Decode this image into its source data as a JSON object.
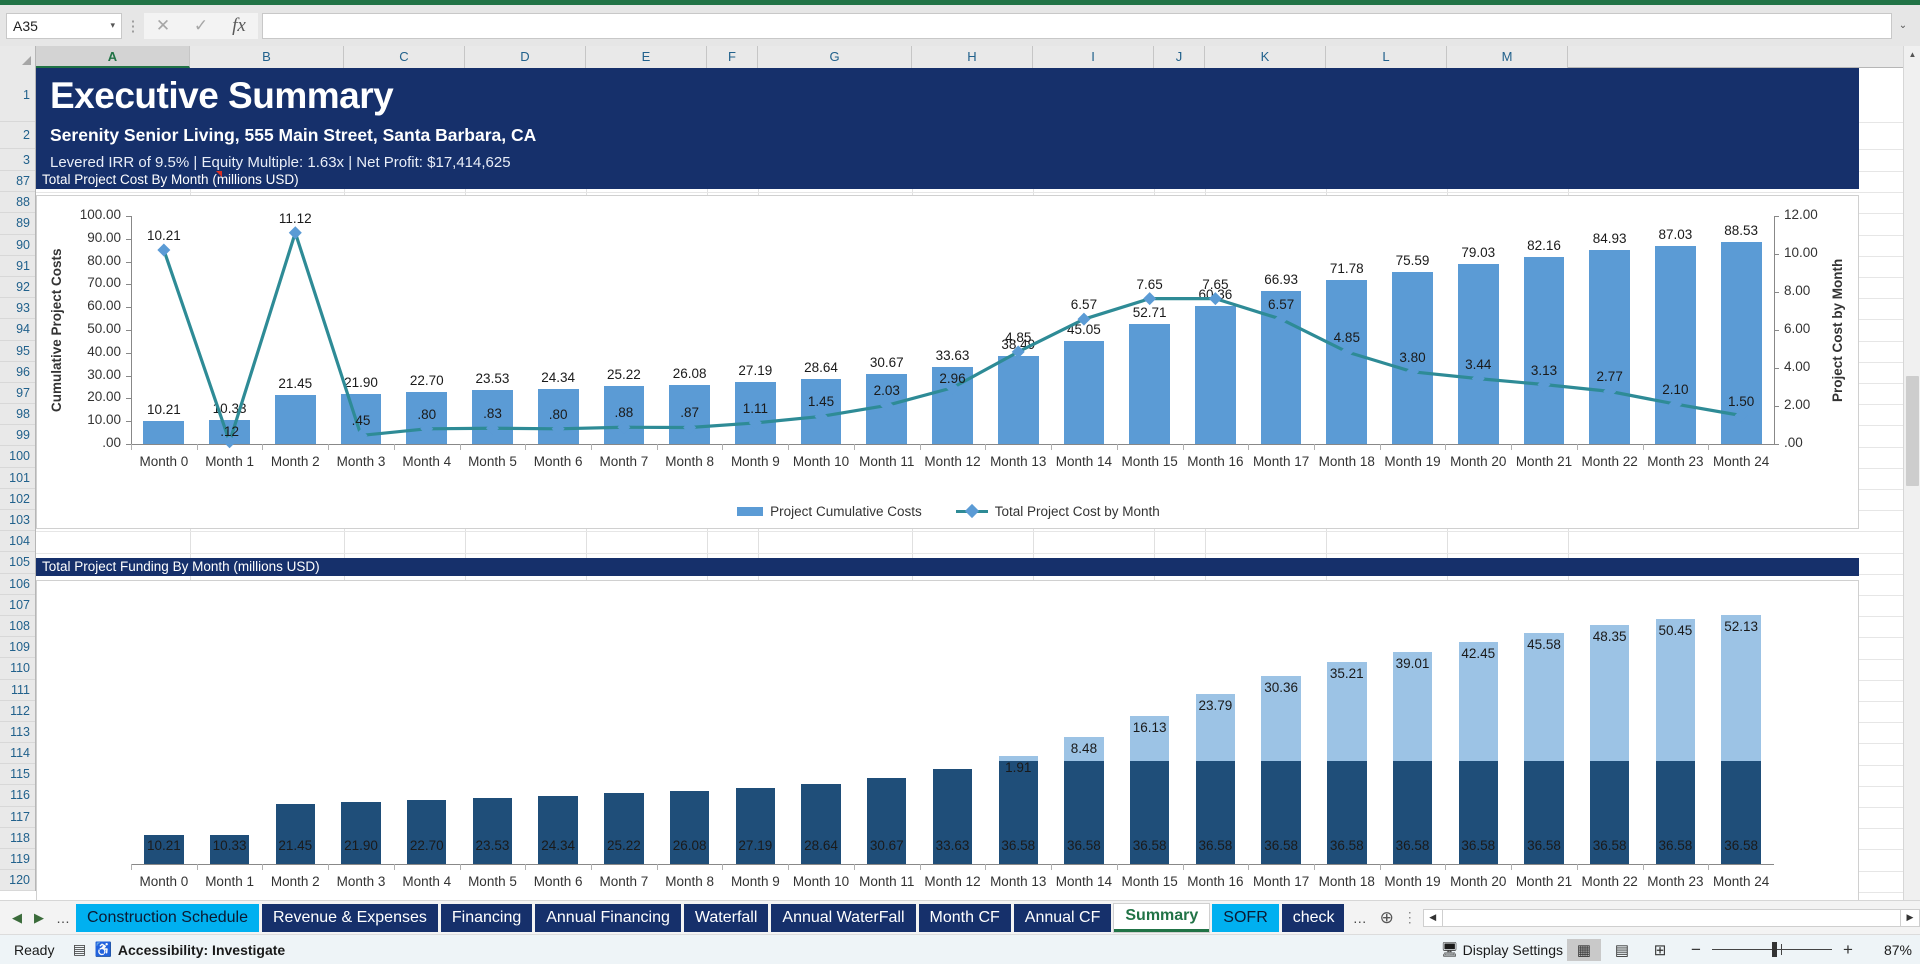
{
  "namebox": {
    "value": "A35",
    "arrow": "▾"
  },
  "formulabar": {
    "cancel": "✕",
    "confirm": "✓",
    "fx": "fx",
    "value": "",
    "expand": "⌄"
  },
  "columns": [
    "A",
    "B",
    "C",
    "D",
    "E",
    "F",
    "G",
    "H",
    "I",
    "J",
    "K",
    "L",
    "M"
  ],
  "rows": [
    "1",
    "2",
    "3",
    "87",
    "88",
    "89",
    "90",
    "91",
    "92",
    "93",
    "94",
    "95",
    "96",
    "97",
    "98",
    "99",
    "100",
    "101",
    "102",
    "103",
    "104",
    "105",
    "106",
    "107",
    "108",
    "109",
    "110",
    "111",
    "112",
    "113",
    "114",
    "115",
    "116",
    "117",
    "118",
    "119",
    "120"
  ],
  "banner": {
    "title": "Executive Summary",
    "subtitle": "Serenity Senior Living, 555 Main Street, Santa Barbara, CA",
    "metrics": "Levered IRR of 9.5% | Equity Multiple: 1.63x | Net Profit: $17,414,625"
  },
  "section_cost": {
    "label": "Total  Project Cost By Month (millions USD)"
  },
  "section_funding": {
    "label": "Total  Project Funding By Month (millions USD)"
  },
  "chart_data": [
    {
      "type": "bar",
      "title": "Total  Project Cost By Month (millions USD)",
      "categories": [
        "Month 0",
        "Month 1",
        "Month 2",
        "Month 3",
        "Month 4",
        "Month 5",
        "Month 6",
        "Month 7",
        "Month 8",
        "Month 9",
        "Month 10",
        "Month 11",
        "Month 12",
        "Month 13",
        "Month 14",
        "Month 15",
        "Month 16",
        "Month 17",
        "Month 18",
        "Month 19",
        "Month 20",
        "Month 21",
        "Month 22",
        "Month 23",
        "Month 24"
      ],
      "series": [
        {
          "name": "Project Cumulative Costs",
          "kind": "bar",
          "axis": "left",
          "color": "#5b9bd5",
          "values": [
            10.21,
            10.33,
            21.45,
            21.9,
            22.7,
            23.53,
            24.34,
            25.22,
            26.08,
            27.19,
            28.64,
            30.67,
            33.63,
            38.49,
            45.05,
            52.71,
            60.36,
            66.93,
            71.78,
            75.59,
            79.03,
            82.16,
            84.93,
            87.03,
            88.53
          ],
          "labels": [
            "10.21",
            "10.33",
            "21.45",
            "21.90",
            "22.70",
            "23.53",
            "24.34",
            "25.22",
            "26.08",
            "27.19",
            "28.64",
            "30.67",
            "33.63",
            "38.49",
            "45.05",
            "52.71",
            "60.36",
            "66.93",
            "71.78",
            "75.59",
            "79.03",
            "82.16",
            "84.93",
            "87.03",
            "88.53"
          ]
        },
        {
          "name": "Total Project Cost by Month",
          "kind": "line",
          "axis": "right",
          "color": "#2e8b96",
          "values": [
            10.21,
            0.12,
            11.12,
            0.45,
            0.8,
            0.83,
            0.8,
            0.88,
            0.87,
            1.11,
            1.45,
            2.03,
            2.96,
            4.85,
            6.57,
            7.65,
            7.65,
            6.57,
            4.85,
            3.8,
            3.44,
            3.13,
            2.77,
            2.1,
            1.5
          ],
          "labels": [
            "10.21",
            ".12",
            "11.12",
            ".45",
            ".80",
            ".83",
            ".80",
            ".88",
            ".87",
            "1.11",
            "1.45",
            "2.03",
            "2.96",
            "4.85",
            "6.57",
            "7.65",
            "7.65",
            "6.57",
            "4.85",
            "3.80",
            "3.44",
            "3.13",
            "2.77",
            "2.10",
            "1.50"
          ]
        }
      ],
      "yaxis_left": {
        "label": "Cumulative Project Costs",
        "ticks": [
          "100.00",
          "90.00",
          "80.00",
          "70.00",
          "60.00",
          "50.00",
          "40.00",
          "30.00",
          "20.00",
          "10.00",
          ".00"
        ],
        "min": 0,
        "max": 100
      },
      "yaxis_right": {
        "label": "Project Cost by Month",
        "ticks": [
          "12.00",
          "10.00",
          "8.00",
          "6.00",
          "4.00",
          "2.00",
          ".00"
        ],
        "min": 0,
        "max": 12
      },
      "legend": [
        "Project Cumulative Costs",
        "Total Project Cost by Month"
      ],
      "legend_position": "bottom",
      "grid": false
    },
    {
      "type": "bar",
      "title": "Total  Project Funding By Month (millions USD)",
      "stacked": true,
      "categories": [
        "Month 0",
        "Month 1",
        "Month 2",
        "Month 3",
        "Month 4",
        "Month 5",
        "Month 6",
        "Month 7",
        "Month 8",
        "Month 9",
        "Month 10",
        "Month 11",
        "Month 12",
        "Month 13",
        "Month 14",
        "Month 15",
        "Month 16",
        "Month 17",
        "Month 18",
        "Month 19",
        "Month 20",
        "Month 21",
        "Month 22",
        "Month 23",
        "Month 24"
      ],
      "series": [
        {
          "name": "equity-funding",
          "kind": "bar",
          "color": "#1f4e79",
          "values": [
            10.21,
            10.33,
            21.45,
            21.9,
            22.7,
            23.53,
            24.34,
            25.22,
            26.08,
            27.19,
            28.64,
            30.67,
            33.63,
            36.58,
            36.58,
            36.58,
            36.58,
            36.58,
            36.58,
            36.58,
            36.58,
            36.58,
            36.58,
            36.58,
            36.58
          ],
          "labels": [
            "10.21",
            "10.33",
            "21.45",
            "21.90",
            "22.70",
            "23.53",
            "24.34",
            "25.22",
            "26.08",
            "27.19",
            "28.64",
            "30.67",
            "33.63",
            "36.58",
            "36.58",
            "36.58",
            "36.58",
            "36.58",
            "36.58",
            "36.58",
            "36.58",
            "36.58",
            "36.58",
            "36.58",
            "36.58"
          ]
        },
        {
          "name": "debt-funding",
          "kind": "bar",
          "color": "#9cc3e5",
          "values": [
            0,
            0,
            0,
            0,
            0,
            0,
            0,
            0,
            0,
            0,
            0,
            0,
            0,
            1.91,
            8.48,
            16.13,
            23.79,
            30.36,
            35.21,
            39.01,
            42.45,
            45.58,
            48.35,
            50.45,
            52.13
          ],
          "labels": [
            "",
            "",
            "",
            "",
            "",
            "",
            "",
            "",
            "",
            "",
            "",
            "",
            "",
            "1.91",
            "8.48",
            "16.13",
            "23.79",
            "30.36",
            "35.21",
            "39.01",
            "42.45",
            "45.58",
            "48.35",
            "50.45",
            "52.13"
          ]
        }
      ],
      "ymax": 95,
      "grid": false
    }
  ],
  "tabs": {
    "nav_prev": "◀",
    "nav_next": "▶",
    "nav_more": "…",
    "items": [
      {
        "label": "Construction Schedule",
        "style": "cyan"
      },
      {
        "label": "Revenue & Expenses",
        "style": "navy"
      },
      {
        "label": "Financing",
        "style": "navy"
      },
      {
        "label": "Annual Financing",
        "style": "navy"
      },
      {
        "label": "Waterfall",
        "style": "navy"
      },
      {
        "label": "Annual WaterFall",
        "style": "navy"
      },
      {
        "label": "Month CF",
        "style": "navy"
      },
      {
        "label": "Annual CF",
        "style": "navy"
      },
      {
        "label": "Summary",
        "style": "active"
      },
      {
        "label": "SOFR",
        "style": "cyan"
      },
      {
        "label": "check",
        "style": "navy"
      }
    ],
    "overflow": "…",
    "add": "⊕",
    "menu": "⋮",
    "scroll_left": "◀",
    "scroll_right": "▶"
  },
  "status": {
    "ready": "Ready",
    "macro_icon": "record-macro-icon",
    "accessibility": "Accessibility: Investigate",
    "display_settings": "Display Settings",
    "view_normal": "normal-view-icon",
    "view_layout": "page-layout-icon",
    "view_break": "page-break-icon",
    "zoom_out": "−",
    "zoom_in": "+",
    "zoom_level": "87%"
  },
  "colors": {
    "banner": "#16306b",
    "bar_blue": "#5b9bd5",
    "line_teal": "#2e8b96",
    "bar_navy": "#1f4e79",
    "bar_light": "#9cc3e5",
    "excel_green": "#217346",
    "tab_cyan": "#00b0f0"
  }
}
